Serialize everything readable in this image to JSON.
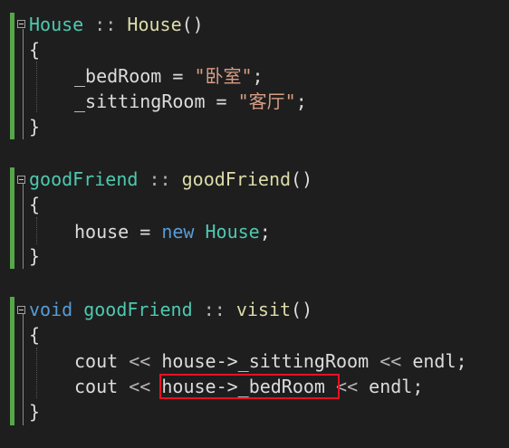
{
  "code": {
    "house_ctor": {
      "class_name": "House",
      "scope_op": "::",
      "method_name": "House",
      "parens": "()",
      "open_brace": "{",
      "close_brace": "}",
      "line1": {
        "var": "_bedRoom",
        "assign": " = ",
        "value": "\"卧室\"",
        "end": ";"
      },
      "line2": {
        "var": "_sittingRoom",
        "assign": " = ",
        "value": "\"客厅\"",
        "end": ";"
      }
    },
    "friend_ctor": {
      "class_name": "goodFriend",
      "scope_op": "::",
      "method_name": "goodFriend",
      "parens": "()",
      "open_brace": "{",
      "close_brace": "}",
      "line1": {
        "var": "house",
        "assign": " = ",
        "keyword": "new",
        "type": "House",
        "end": ";"
      }
    },
    "visit": {
      "return_type": "void",
      "class_name": "goodFriend",
      "scope_op": "::",
      "method_name": "visit",
      "parens": "()",
      "open_brace": "{",
      "close_brace": "}",
      "line1": {
        "stream": "cout",
        "op1": "<<",
        "expr": "house->_sittingRoom",
        "op2": "<<",
        "endl": "endl",
        "end": ";"
      },
      "line2": {
        "stream": "cout",
        "op1": "<<",
        "expr": "house->_bedRoom",
        "op2": "<<",
        "endl": "endl",
        "end": ";"
      }
    }
  },
  "colors": {
    "background": "#1e1e1e",
    "change_bar": "#57a64a",
    "type": "#4ec9b0",
    "function": "#dcdcaa",
    "keyword": "#569cd6",
    "string": "#d69d85",
    "highlight_border": "#e81123"
  }
}
